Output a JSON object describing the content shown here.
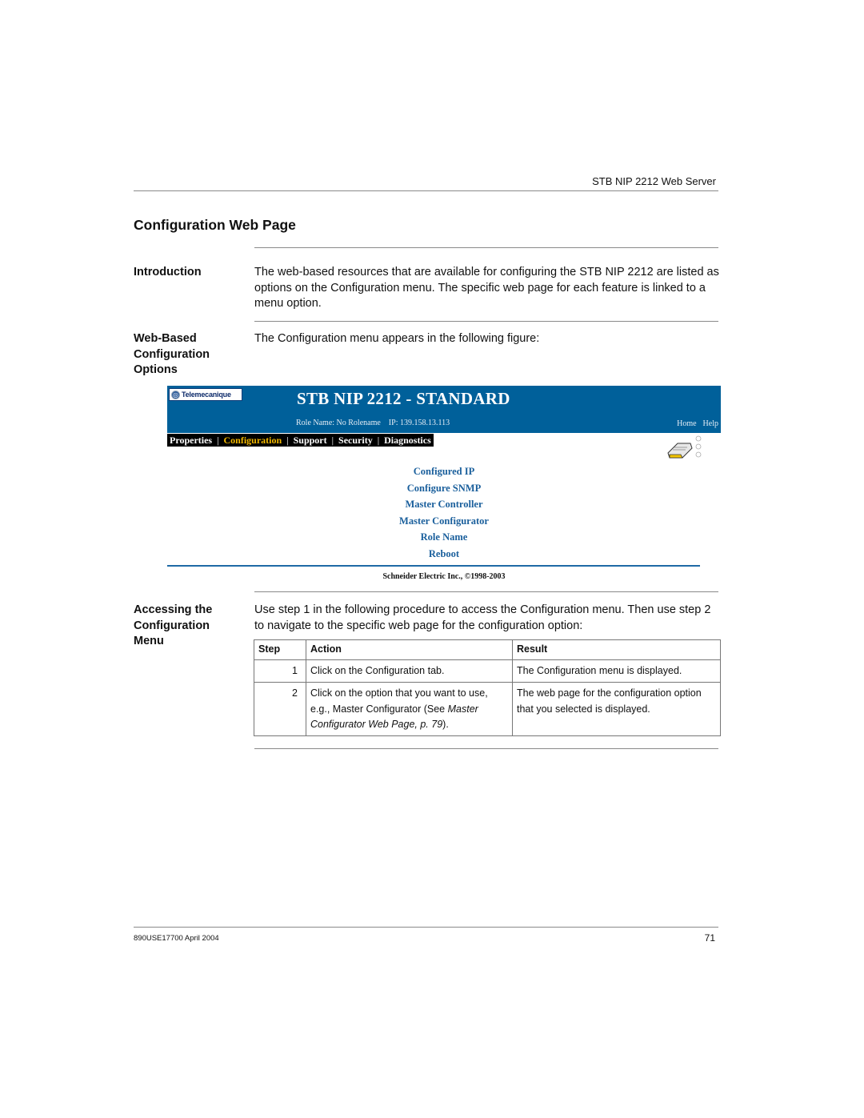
{
  "running_header": "STB NIP 2212 Web Server",
  "page_title": "Configuration Web Page",
  "sections": {
    "introduction": {
      "heading": "Introduction",
      "body": "The web-based resources that are available for configuring the STB NIP 2212 are listed as options on the Configuration menu. The specific web page for each feature is linked to a menu option."
    },
    "web_based": {
      "heading": "Web-Based Configuration Options",
      "body": "The Configuration menu appears in the following figure:"
    },
    "accessing": {
      "heading": "Accessing the Configuration Menu",
      "body": "Use step 1 in the following procedure to access the Configuration menu. Then use step 2 to navigate to the specific web page for the configuration option:"
    }
  },
  "figure": {
    "logo_text": "Telemecanique",
    "logo_icon": "globe-icon",
    "title": "STB NIP 2212 - STANDARD",
    "role_line": "Role Name: No Rolename    IP: 139.158.13.113",
    "links": [
      "Home",
      "Help"
    ],
    "tabs": [
      {
        "label": "Properties",
        "active": false
      },
      {
        "label": "Configuration",
        "active": true
      },
      {
        "label": "Support",
        "active": false
      },
      {
        "label": "Security",
        "active": false
      },
      {
        "label": "Diagnostics",
        "active": false
      }
    ],
    "device_icon": "network-module-icon",
    "menu_items": [
      "Configured IP",
      "Configure SNMP",
      "Master Controller",
      "Master Configurator",
      "Role Name",
      "Reboot"
    ],
    "copyright": "Schneider Electric Inc., ©1998-2003",
    "colors": {
      "banner": "#00609a",
      "active_tab": "#f2b800",
      "menu_link": "#1a5f9c"
    }
  },
  "table": {
    "headers": [
      "Step",
      "Action",
      "Result"
    ],
    "rows": [
      {
        "step": "1",
        "action": "Click on the Configuration tab.",
        "result": "The Configuration menu is displayed."
      },
      {
        "step": "2",
        "action_prefix": "Click on the option that you want to use, e.g., Master Configurator (See ",
        "action_ref": "Master Configurator Web Page, p. 79",
        "action_suffix": ").",
        "result": "The web page for the configuration option that you selected is displayed."
      }
    ]
  },
  "footer": {
    "doc_id": "890USE17700 April 2004",
    "page_number": "71"
  }
}
